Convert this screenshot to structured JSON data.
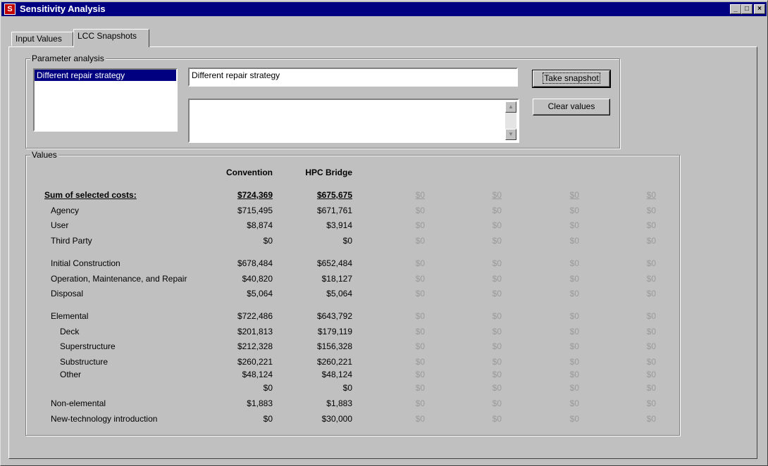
{
  "window": {
    "title": "Sensitivity Analysis",
    "controls": [
      "_",
      "□",
      "×"
    ]
  },
  "tabs": [
    {
      "label": "Input Values",
      "active": false
    },
    {
      "label": "LCC Snapshots",
      "active": true
    }
  ],
  "parameter_analysis": {
    "legend": "Parameter analysis",
    "list_items": [
      "Different repair strategy"
    ],
    "name_value": "Different repair strategy",
    "notes_value": "",
    "take_snapshot_label": "Take snapshot",
    "clear_values_label": "Clear values"
  },
  "values": {
    "legend": "Values",
    "columns": [
      "Convention",
      "HPC Bridge",
      "",
      "",
      "",
      ""
    ],
    "sum_row": {
      "label": "Sum of selected costs:",
      "values": [
        "$724,369",
        "$675,675",
        "$0",
        "$0",
        "$0",
        "$0"
      ]
    },
    "rows": [
      {
        "label": "Agency",
        "values": [
          "$715,495",
          "$671,761",
          "$0",
          "$0",
          "$0",
          "$0"
        ]
      },
      {
        "label": "User",
        "values": [
          "$8,874",
          "$3,914",
          "$0",
          "$0",
          "$0",
          "$0"
        ]
      },
      {
        "label": "Third Party",
        "values": [
          "$0",
          "$0",
          "$0",
          "$0",
          "$0",
          "$0"
        ]
      },
      {
        "label": "Initial Construction",
        "values": [
          "$678,484",
          "$652,484",
          "$0",
          "$0",
          "$0",
          "$0"
        ]
      },
      {
        "label": "Operation, Maintenance, and Repair",
        "values": [
          "$40,820",
          "$18,127",
          "$0",
          "$0",
          "$0",
          "$0"
        ]
      },
      {
        "label": "Disposal",
        "values": [
          "$5,064",
          "$5,064",
          "$0",
          "$0",
          "$0",
          "$0"
        ]
      },
      {
        "label": "Elemental",
        "values": [
          "$722,486",
          "$643,792",
          "$0",
          "$0",
          "$0",
          "$0"
        ]
      },
      {
        "label": "Deck",
        "values": [
          "$201,813",
          "$179,119",
          "$0",
          "$0",
          "$0",
          "$0"
        ]
      },
      {
        "label": "Superstructure",
        "values": [
          "$212,328",
          "$156,328",
          "$0",
          "$0",
          "$0",
          "$0"
        ]
      },
      {
        "label": "Substructure",
        "values": [
          "$260,221",
          "$260,221",
          "$0",
          "$0",
          "$0",
          "$0"
        ]
      },
      {
        "label": "Other",
        "values": [
          "$48,124",
          "$48,124",
          "$0",
          "$0",
          "$0",
          "$0"
        ]
      },
      {
        "label": "",
        "values": [
          "$0",
          "$0",
          "$0",
          "$0",
          "$0",
          "$0"
        ]
      },
      {
        "label": "Non-elemental",
        "values": [
          "$1,883",
          "$1,883",
          "$0",
          "$0",
          "$0",
          "$0"
        ]
      },
      {
        "label": "New-technology introduction",
        "values": [
          "$0",
          "$30,000",
          "$0",
          "$0",
          "$0",
          "$0"
        ]
      }
    ]
  }
}
